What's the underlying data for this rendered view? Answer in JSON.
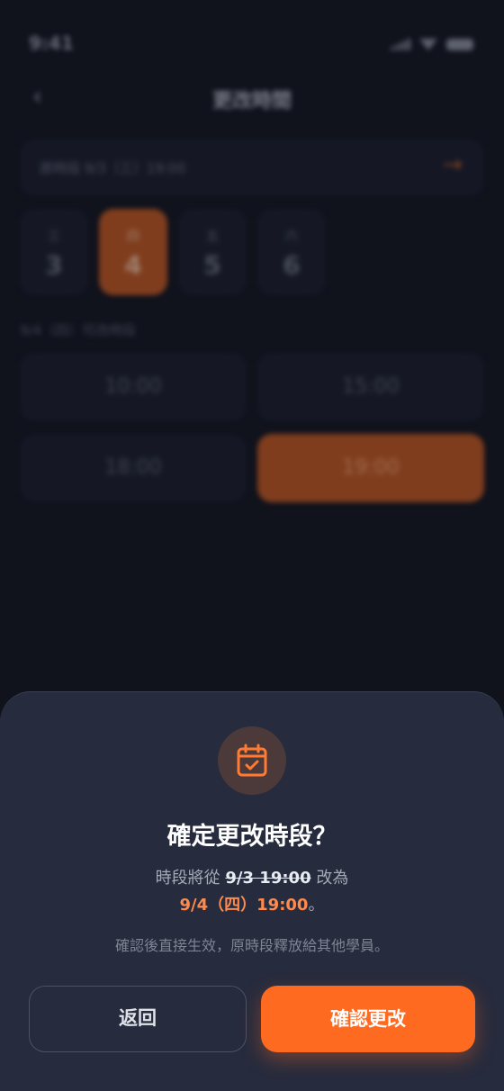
{
  "status_bar": {
    "time": "9:41"
  },
  "nav": {
    "back_icon": "chevron-left-icon",
    "title": "更改時間"
  },
  "original": {
    "text": "原時段 9/3（三）19:00",
    "arrow_icon": "arrow-right-icon"
  },
  "days": [
    {
      "weekday": "三",
      "day": "3",
      "selected": false
    },
    {
      "weekday": "四",
      "day": "4",
      "selected": true
    },
    {
      "weekday": "五",
      "day": "5",
      "selected": false
    },
    {
      "weekday": "六",
      "day": "6",
      "selected": false
    }
  ],
  "slots_label": "9/4（四）可改時段",
  "slots": [
    {
      "time": "10:00",
      "selected": false
    },
    {
      "time": "15:00",
      "selected": false
    },
    {
      "time": "18:00",
      "selected": false
    },
    {
      "time": "19:00",
      "selected": true
    }
  ],
  "dialog": {
    "icon": "calendar-check-icon",
    "title": "確定更改時段？",
    "line1_prefix": "時段將從",
    "line1_old": "9/3 19:00",
    "line1_suffix": "改為",
    "line2_new": "9/4（四）19:00",
    "line2_suffix": "。",
    "note": "確認後直接生效，原時段釋放給其他學員。",
    "back_label": "返回",
    "confirm_label": "確認更改"
  },
  "colors": {
    "accent": "#ff6a21",
    "sheet_bg": "#262b3d",
    "screen_bg": "#141823"
  }
}
